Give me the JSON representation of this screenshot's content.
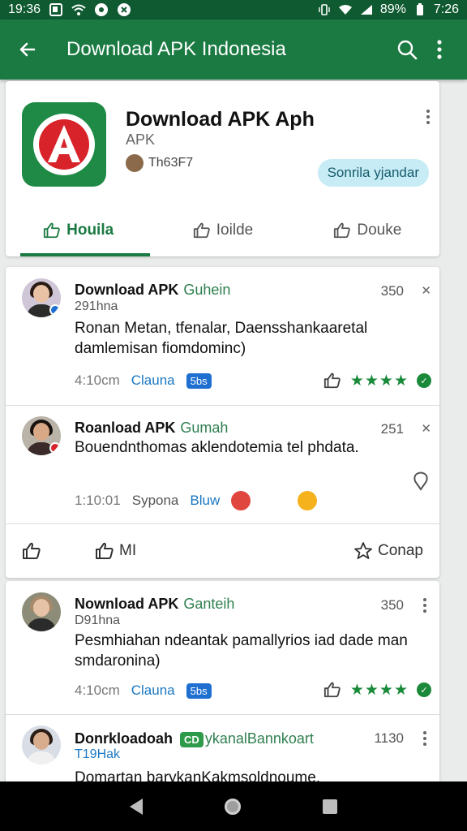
{
  "status_bar": {
    "time": "19:36",
    "battery": "89%",
    "clock_right": "7:26"
  },
  "app_bar": {
    "title": "Download APK Indonesia"
  },
  "app": {
    "name": "Download APK Aph",
    "type": "APK",
    "developer": "Th63F7",
    "install_pill": "Sonrila yjandar",
    "icon_color": "#1e8a45"
  },
  "tabs": [
    {
      "label": "Houila",
      "active": true
    },
    {
      "label": "Ioilde",
      "active": false
    },
    {
      "label": "Douke",
      "active": false
    }
  ],
  "reviews": [
    {
      "author": "Download APK",
      "tag": "Guhein",
      "date": "291hna",
      "count": "350",
      "text": "Ronan Metan, tfenalar, Daensshankaaretal damlemisan fiomdominc)",
      "time": "4:10cm",
      "link": "Clauna",
      "badge": "5bs",
      "stars": "★★★★",
      "verified": "✓"
    },
    {
      "author": "Roanload APK",
      "tag": "Gumah",
      "count": "251",
      "text": "Bouendnthomas aklendotemia tel phdata.",
      "time": "1:10:01",
      "link_a": "Sypona",
      "link_b": "Bluw",
      "actions": {
        "like_count": "",
        "reply": "MI",
        "save": "Conap"
      }
    },
    {
      "author": "Nownload APK",
      "tag": "Ganteih",
      "date": "D91hna",
      "count": "350",
      "text": "Pesmhiahan ndeantak pamallyrios iad dade man smdaronina)",
      "time": "4:10cm",
      "link": "Clauna",
      "badge": "5bs",
      "stars": "★★★★",
      "verified": "✓"
    },
    {
      "author": "Donrkloadoah",
      "tag": "ykanalBannkoart",
      "tag_badge": "CD",
      "date": "T19Hak",
      "count": "1130",
      "text": "Domartan barykanKakmsoldnoume."
    }
  ],
  "colors": {
    "primary": "#1a7a42",
    "status": "#0f5a30",
    "star": "#1a8a3a",
    "link": "#1b78c2"
  }
}
